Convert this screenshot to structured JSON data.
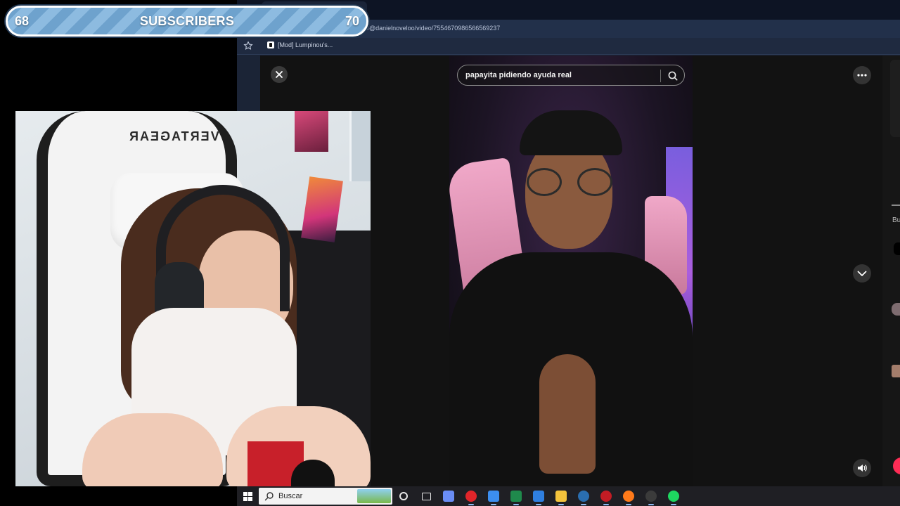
{
  "goal": {
    "current": "68",
    "label": "SUBSCRIBERS",
    "target": "70"
  },
  "browser": {
    "url": ".com/@danielnoveloo/video/7554670986566569237",
    "bookmark_label": "[Mod] Lumpinou's..."
  },
  "tiktok": {
    "search_query": "papayita pidiendo ayuda real",
    "side_text": "Bu"
  },
  "webcam": {
    "chair_logo": "VERTAGEAR"
  },
  "taskbar": {
    "search_label": "Buscar",
    "apps": [
      {
        "name": "cortana-icon",
        "color": "#e6e6e6"
      },
      {
        "name": "task-view-icon",
        "color": "#e6e6e6"
      },
      {
        "name": "copilot-icon",
        "color": "#6a8df5"
      },
      {
        "name": "opera-icon",
        "color": "#e1252a"
      },
      {
        "name": "store-icon",
        "color": "#3c8ef0"
      },
      {
        "name": "excel-icon",
        "color": "#1f8a4c"
      },
      {
        "name": "outlook-icon",
        "color": "#2f7fe0"
      },
      {
        "name": "file-explorer-icon",
        "color": "#f3c33c"
      },
      {
        "name": "steam-icon",
        "color": "#2a6eb0"
      },
      {
        "name": "red-app-icon",
        "color": "#c31c24"
      },
      {
        "name": "firefox-icon",
        "color": "#ff7a1a"
      },
      {
        "name": "obs-icon",
        "color": "#3b3b3b"
      },
      {
        "name": "spotify-icon",
        "color": "#1ed760"
      }
    ]
  }
}
